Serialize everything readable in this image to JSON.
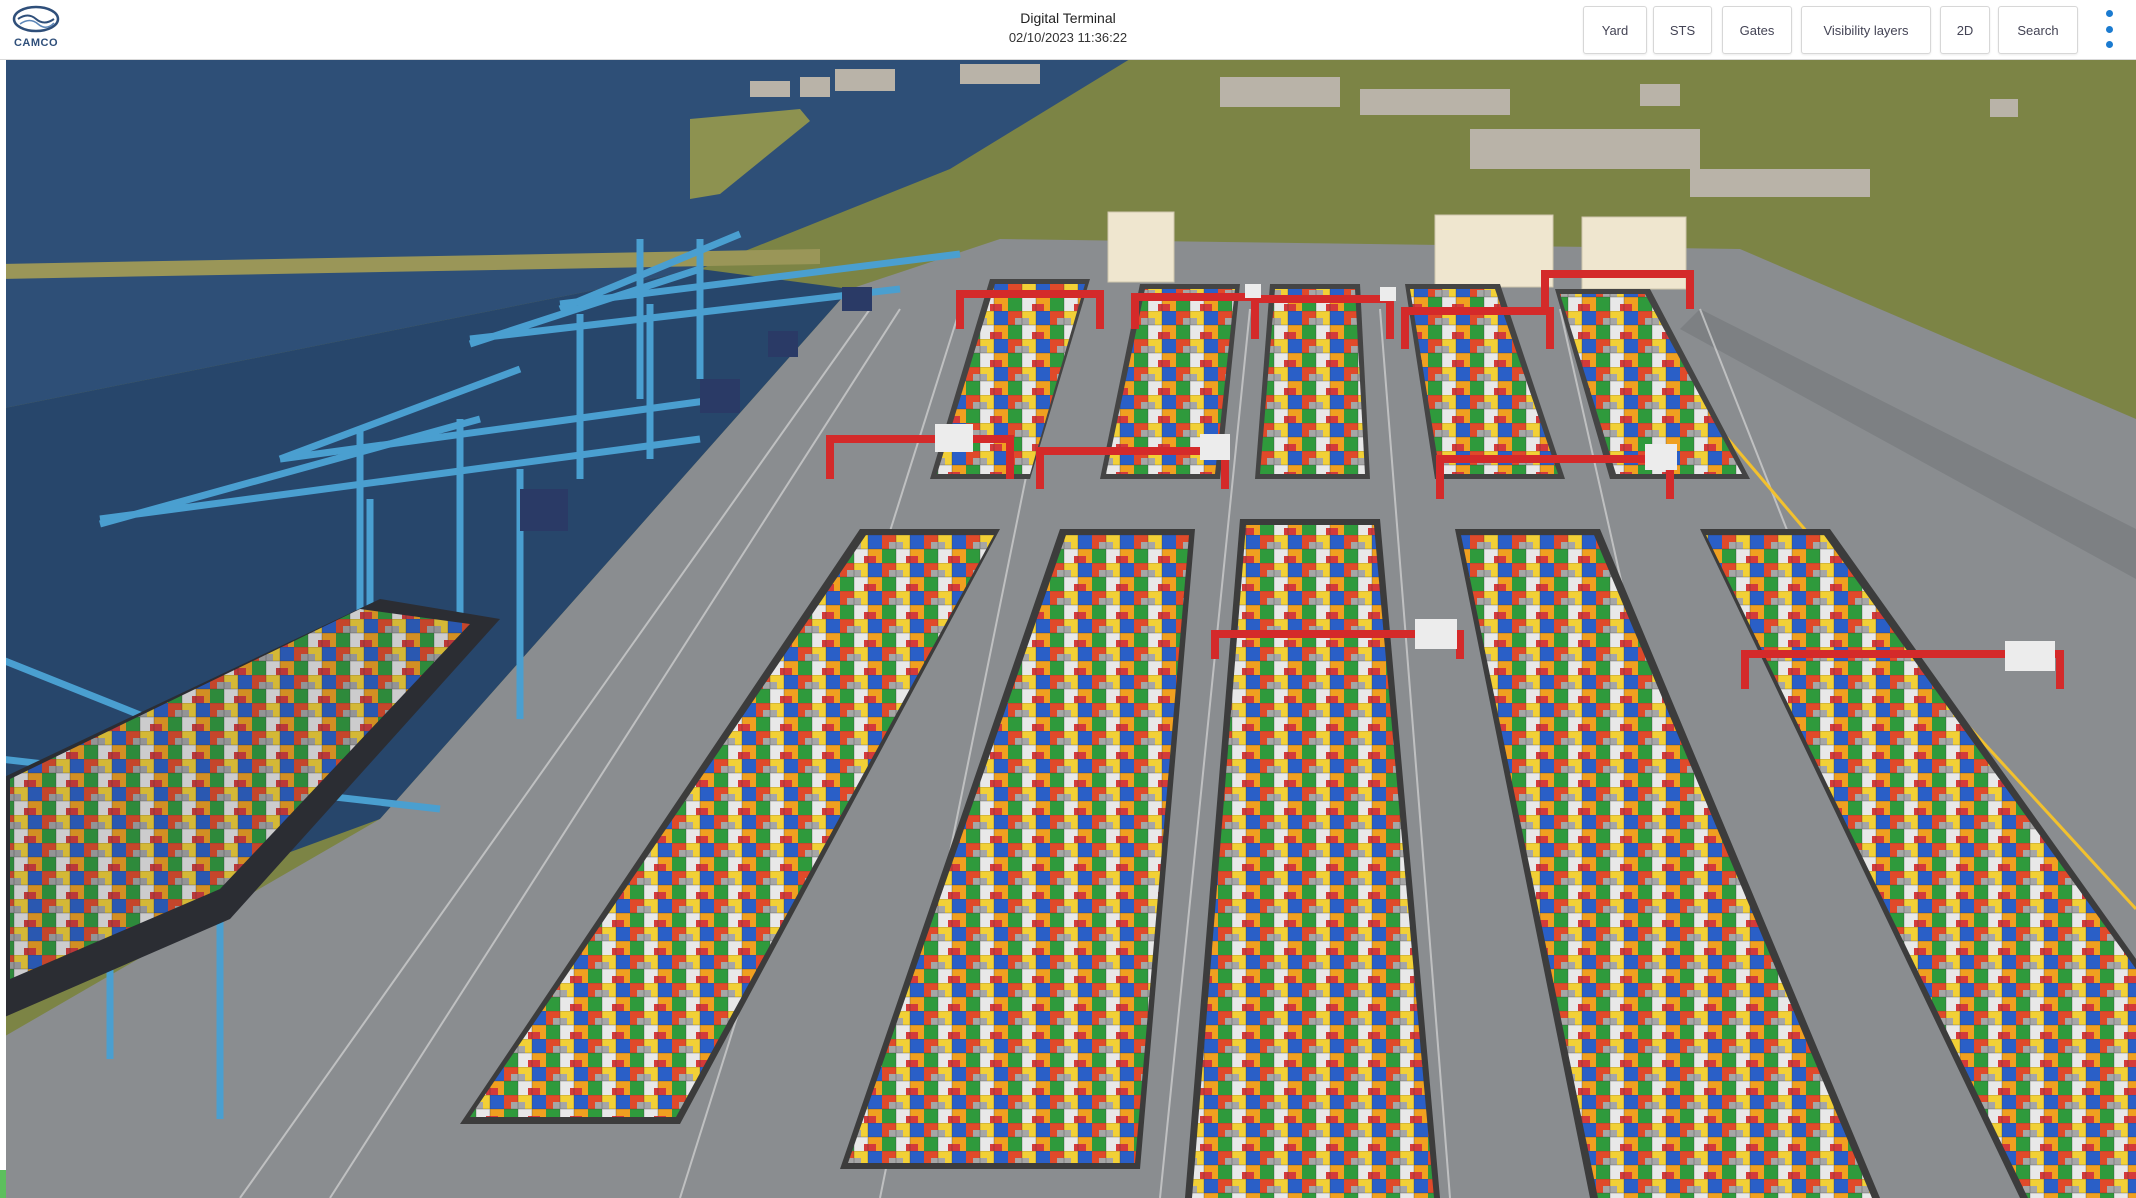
{
  "header": {
    "logo_text": "CAMCO",
    "title": "Digital Terminal",
    "datetime": "02/10/2023 11:36:22"
  },
  "nav": {
    "yard": "Yard",
    "sts": "STS",
    "gates": "Gates",
    "visibility_layers": "Visibility layers",
    "view_2d": "2D",
    "search": "Search"
  },
  "colors": {
    "accent": "#1b7bd0",
    "sea": "#2e4f77",
    "land": "#7f8a45",
    "quay": "#8a8d90",
    "sts_crane": "#4a9fd0",
    "rtg_crane": "#d42a2a",
    "containers": [
      "#e04a2a",
      "#f0a020",
      "#f2d036",
      "#2f9a3c",
      "#2a5fc7",
      "#e8e8e8",
      "#a6a6a6",
      "#3aa8c8"
    ]
  },
  "icons": {
    "logo": "camco-logo-icon",
    "menu": "kebab-menu-icon"
  }
}
